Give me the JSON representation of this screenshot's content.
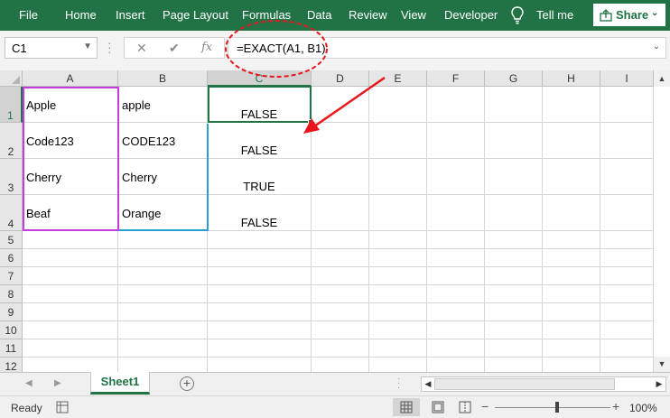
{
  "ribbon": {
    "tabs": [
      "File",
      "Home",
      "Insert",
      "Page Layout",
      "Formulas",
      "Data",
      "Review",
      "View",
      "Developer"
    ],
    "tell_me": "Tell me",
    "share_label": "Share",
    "share_chevron": "⌄",
    "bg_color": "#217346"
  },
  "formula_bar": {
    "name_box": "C1",
    "cancel_symbol": "✕",
    "enter_symbol": "✔",
    "fx_symbol": "fx",
    "formula": "=EXACT(A1, B1)"
  },
  "grid": {
    "columns": [
      "A",
      "B",
      "C",
      "D",
      "E",
      "F",
      "G",
      "H",
      "I"
    ],
    "rows": [
      "1",
      "2",
      "3",
      "4",
      "5",
      "6",
      "7",
      "8",
      "9",
      "10",
      "11",
      "12"
    ],
    "selected_cell": "C1",
    "cells": {
      "A1": "Apple",
      "B1": "apple",
      "C1": "FALSE",
      "A2": "Code123",
      "B2": "CODE123",
      "C2": "FALSE",
      "A3": "Cherry",
      "B3": "Cherry",
      "C3": "TRUE",
      "A4": "Beaf",
      "B4": "Orange",
      "C4": "FALSE"
    }
  },
  "annotations": {
    "ellipse_color": "#e8161b",
    "arrow_color": "#e8161b",
    "range_a_border": "#c23ddb",
    "range_b_border": "#c23ddb",
    "range_c_border": "#2a9fd6"
  },
  "sheet_tabs": {
    "active": "Sheet1",
    "add_symbol": "+"
  },
  "status_bar": {
    "status": "Ready",
    "zoom_minus": "−",
    "zoom_plus": "+",
    "zoom_level": "100%"
  }
}
